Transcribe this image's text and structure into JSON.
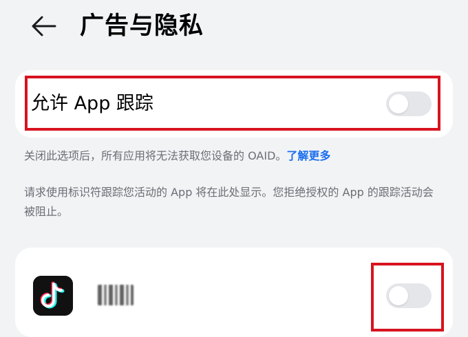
{
  "header": {
    "back_icon": "arrow-left-icon",
    "title": "广告与隐私"
  },
  "tracking": {
    "label": "允许 App 跟踪",
    "enabled": false
  },
  "description": {
    "line1": "关闭此选项后，所有应用将无法获取您设备的 OAID。",
    "learn_more": "了解更多",
    "line2": "请求使用标识符跟踪您活动的 App 将在此处显示。您拒绝授权的 App 的跟踪活动会被阻止。"
  },
  "apps": [
    {
      "icon": "tiktok-icon",
      "name_obscured": true,
      "enabled": false
    }
  ],
  "colors": {
    "background": "#f1f3f5",
    "card": "#ffffff",
    "link": "#1a6ef0",
    "highlight": "#d8131f",
    "switch_off": "#e4e6e9"
  }
}
